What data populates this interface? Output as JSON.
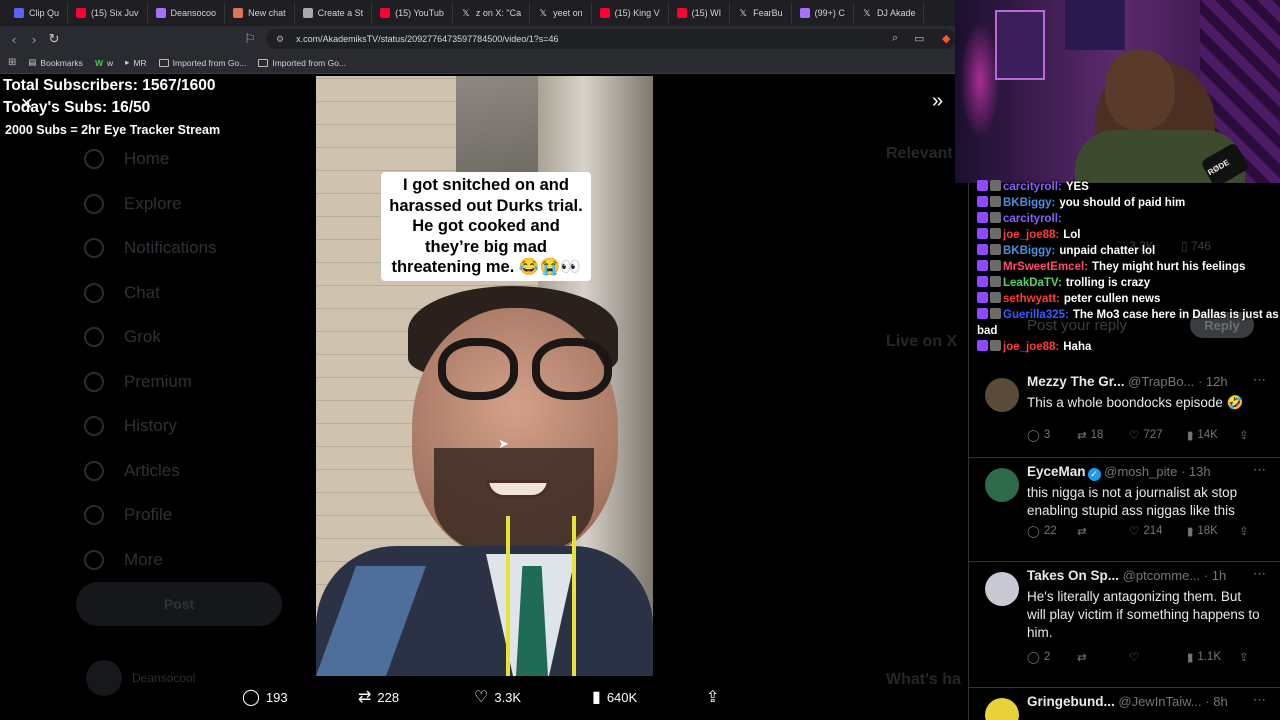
{
  "tabs": [
    {
      "label": "Clip Qu",
      "icon": "clip-icon",
      "color": "#5865f2"
    },
    {
      "label": "(15) Six Juv",
      "icon": "youtube-icon",
      "color": "#ff0033"
    },
    {
      "label": "Deansocoo",
      "icon": "twitch-icon",
      "color": "#a970ff"
    },
    {
      "label": "New chat",
      "icon": "claude-icon",
      "color": "#d97757"
    },
    {
      "label": "Create a St",
      "icon": "doc-icon",
      "color": "#aaaaaa"
    },
    {
      "label": "(15) YouTub",
      "icon": "youtube-icon",
      "color": "#ff0033"
    },
    {
      "label": "z on X: \"Ca",
      "icon": "x-icon",
      "color": "#000000"
    },
    {
      "label": "yeet on",
      "icon": "x-icon",
      "color": "#000000"
    },
    {
      "label": "(15) King V",
      "icon": "youtube-icon",
      "color": "#ff0033"
    },
    {
      "label": "(15) WI",
      "icon": "youtube-icon",
      "color": "#ff0033"
    },
    {
      "label": "FearBu",
      "icon": "x-icon",
      "color": "#000000"
    },
    {
      "label": "(99+) C",
      "icon": "twitch-icon",
      "color": "#a970ff"
    },
    {
      "label": "DJ Akade",
      "icon": "x-icon",
      "color": "#000000"
    }
  ],
  "address": {
    "url": "x.com/AkademiksTV/status/2092776473597784500/video/1?s=46"
  },
  "bookmarks": [
    {
      "label": "Bookmarks",
      "icon": "bookmarks-icon"
    },
    {
      "label": "w",
      "icon": "w-icon"
    },
    {
      "label": "MR",
      "icon": "mr-icon"
    },
    {
      "label": "Imported from Go...",
      "icon": "folder-icon"
    },
    {
      "label": "Imported from Go...",
      "icon": "folder-icon"
    }
  ],
  "overlay": {
    "total_subs": "Total Subscribers: 1567/1600",
    "todays_subs": "Today's Subs: 16/50",
    "goal": "2000 Subs = 2hr Eye Tracker Stream"
  },
  "nav": [
    {
      "label": "Home",
      "icon": "home-icon"
    },
    {
      "label": "Explore",
      "icon": "search-icon"
    },
    {
      "label": "Notifications",
      "icon": "bell-icon"
    },
    {
      "label": "Chat",
      "icon": "chat-icon"
    },
    {
      "label": "Grok",
      "icon": "grok-icon"
    },
    {
      "label": "Premium",
      "icon": "premium-icon"
    },
    {
      "label": "History",
      "icon": "history-icon"
    },
    {
      "label": "Articles",
      "icon": "articles-icon"
    },
    {
      "label": "Profile",
      "icon": "profile-icon"
    },
    {
      "label": "More",
      "icon": "more-icon"
    }
  ],
  "post_button": "Post",
  "account": {
    "name": "Deansocool"
  },
  "right_ghost": {
    "relevant": "Relevant",
    "live": "Live on X",
    "whats": "What's ha"
  },
  "video": {
    "caption": "I got snitched on and harassed out Durks trial. He got cooked and they’re big mad threatening me. 😂😭👀",
    "stats": {
      "replies": "193",
      "reposts": "228",
      "likes": "3.3K",
      "views": "640K"
    }
  },
  "cam": {
    "mic_brand": "RØDE"
  },
  "chat": [
    {
      "name": "carcityroll:",
      "text": "YES",
      "color": "#8a5cff"
    },
    {
      "name": "BKBiggy:",
      "text": "you should of paid him",
      "color": "#4a90e2"
    },
    {
      "name": "carcityroll:",
      "text": "",
      "color": "#8a5cff"
    },
    {
      "name": "joe_joe88:",
      "text": "Lol",
      "color": "#ff3b3b"
    },
    {
      "name": "BKBiggy:",
      "text": "unpaid chatter lol",
      "color": "#4a90e2"
    },
    {
      "name": "MrSweetEmcel:",
      "text": "They might hurt his feelings",
      "color": "#ff4a6b"
    },
    {
      "name": "LeakDaTV:",
      "text": "trolling is crazy",
      "color": "#4cd964"
    },
    {
      "name": "sethwyatt:",
      "text": "peter cullen news",
      "color": "#ff3b3b"
    },
    {
      "name": "Guerilla325:",
      "text": "The Mo3 case here in Dallas is just as bad",
      "color": "#3b5bff"
    },
    {
      "name": "joe_joe88:",
      "text": "Haha",
      "color": "#ff3b3b"
    }
  ],
  "reply_button": "Reply",
  "reply_placeholder": "Post your reply",
  "bg_stats": {
    "likes": "3.3K",
    "bookmarks": "746"
  },
  "tweets": [
    {
      "name": "Mezzy The Gr...",
      "handle": "@TrapBo...",
      "time": "12h",
      "text": "This a whole boondocks episode 🤣",
      "replies": "3",
      "reposts": "18",
      "likes": "727",
      "views": "14K",
      "avatar_color": "#5a4a3a"
    },
    {
      "name": "EyceMan",
      "handle": "@mosh_pite",
      "time": "13h",
      "text": "this nigga is not a journalist ak stop enabling stupid ass niggas like this",
      "replies": "22",
      "reposts": "",
      "likes": "214",
      "views": "18K",
      "verified": true,
      "avatar_color": "#2d6a4a"
    },
    {
      "name": "Takes On Sp...",
      "handle": "@ptcomme...",
      "time": "1h",
      "text": "He's literally antagonizing them. But will play victim if something happens to him.",
      "replies": "2",
      "reposts": "",
      "likes": "",
      "views": "1.1K",
      "avatar_color": "#c9c9d4"
    },
    {
      "name": "Gringebund...",
      "handle": "@JewInTaiw...",
      "time": "8h",
      "text": "",
      "avatar_color": "#e8d23a"
    }
  ]
}
